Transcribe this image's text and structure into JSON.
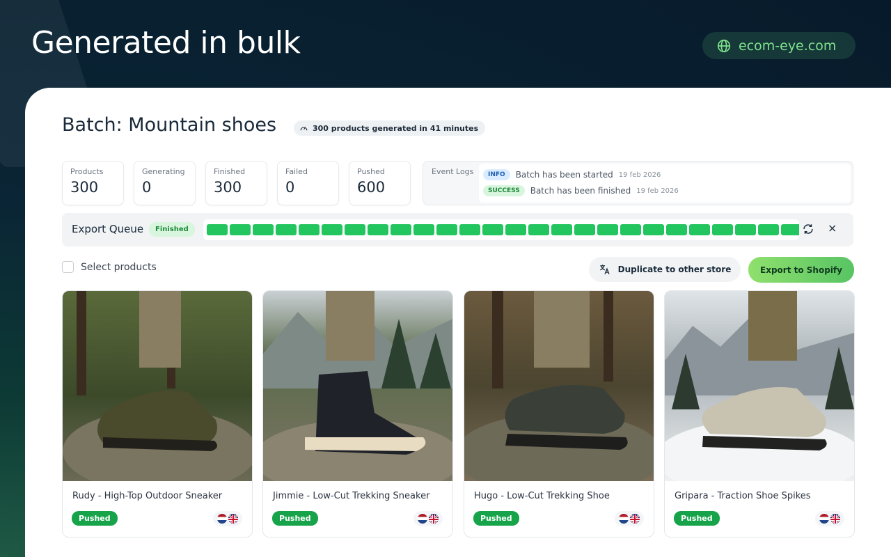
{
  "hero": {
    "headline": "Generated in bulk",
    "domain": "ecom-eye.com",
    "domain_icon": "globe-icon"
  },
  "batch": {
    "title": "Batch: Mountain shoes",
    "generated_summary": "300 products generated in 41 minutes",
    "summary_icon": "gauge-icon"
  },
  "stats": [
    {
      "label": "Products",
      "value": "300"
    },
    {
      "label": "Generating",
      "value": "0"
    },
    {
      "label": "Finished",
      "value": "300"
    },
    {
      "label": "Failed",
      "value": "0"
    },
    {
      "label": "Pushed",
      "value": "600"
    }
  ],
  "event_logs": {
    "label": "Event Logs",
    "entries": [
      {
        "level": "INFO",
        "message": "Batch has been started",
        "date": "19 feb 2026"
      },
      {
        "level": "SUCCESS",
        "message": "Batch has been finished",
        "date": "19 feb 2026"
      }
    ]
  },
  "export_queue": {
    "title": "Export Queue",
    "status": "Finished",
    "progress": 1.0,
    "segments_visible": 26,
    "refresh_icon": "refresh-icon",
    "close_icon": "close-icon",
    "close_glyph": "×"
  },
  "toolbar": {
    "select_label": "Select products",
    "duplicate_label": "Duplicate to other store",
    "duplicate_icon": "translate-icon",
    "export_label": "Export to Shopify"
  },
  "products": [
    {
      "name": "Rudy - High-Top Outdoor Sneaker",
      "status": "Pushed",
      "flags": [
        "nl",
        "gb"
      ]
    },
    {
      "name": "Jimmie - Low-Cut Trekking Sneaker",
      "status": "Pushed",
      "flags": [
        "nl",
        "gb"
      ]
    },
    {
      "name": "Hugo - Low-Cut Trekking Shoe",
      "status": "Pushed",
      "flags": [
        "nl",
        "gb"
      ]
    },
    {
      "name": "Gripara - Traction Shoe Spikes",
      "status": "Pushed",
      "flags": [
        "nl",
        "gb"
      ]
    }
  ],
  "colors": {
    "accent_green": "#22c55e",
    "pushed_green": "#16a34a",
    "domain_text": "#7fe38e"
  }
}
